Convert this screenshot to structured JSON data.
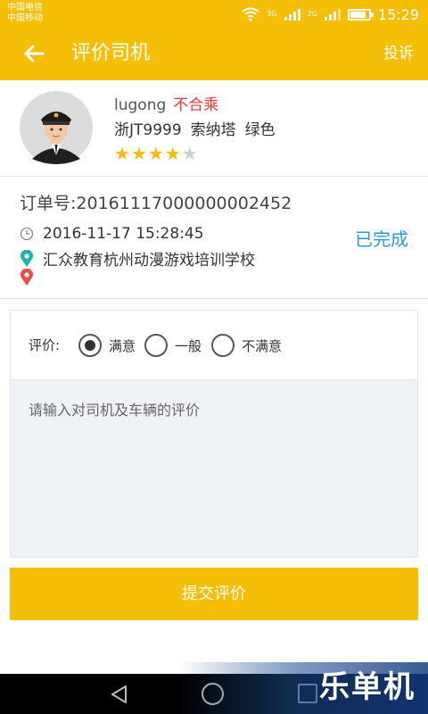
{
  "status_bar": {
    "carrier_1": "中国电信",
    "carrier_2": "中国移动",
    "net_1": "3G",
    "net_2": "2G",
    "time": "15:29",
    "battery_level": 0.8
  },
  "header": {
    "title": "评价司机",
    "right_action": "投诉",
    "color": "#f5bf08"
  },
  "driver": {
    "name": "lugong",
    "badge": "不合乘",
    "plate": "浙JT9999",
    "car_model": "索纳塔",
    "car_color": "绿色",
    "rating": 4,
    "rating_max": 5
  },
  "order": {
    "label": "订单号:",
    "number": "20161117000000002452",
    "time": "2016-11-17 15:28:45",
    "start_place": "汇众教育杭州动漫游戏培训学校",
    "end_place": "",
    "status": "已完成"
  },
  "rating_form": {
    "label": "评价:",
    "options": [
      "满意",
      "一般",
      "不满意"
    ],
    "selected": "满意",
    "comment_placeholder": "请输入对司机及车辆的评价"
  },
  "submit_label": "提交评价",
  "watermark": "乐单机"
}
